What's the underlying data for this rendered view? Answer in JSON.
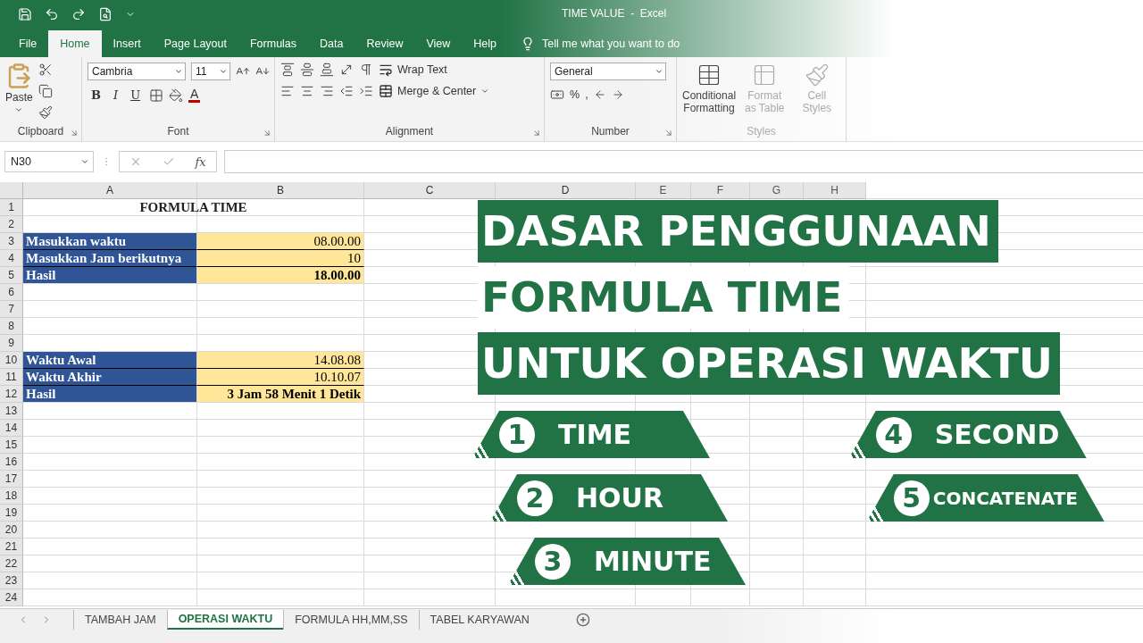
{
  "title_bar": {
    "title": "TIME VALUE  -  Excel"
  },
  "ribbon_tabs": [
    {
      "label": "File",
      "selected": false
    },
    {
      "label": "Home",
      "selected": true
    },
    {
      "label": "Insert",
      "selected": false
    },
    {
      "label": "Page Layout",
      "selected": false
    },
    {
      "label": "Formulas",
      "selected": false
    },
    {
      "label": "Data",
      "selected": false
    },
    {
      "label": "Review",
      "selected": false
    },
    {
      "label": "View",
      "selected": false
    },
    {
      "label": "Help",
      "selected": false
    }
  ],
  "tell_me": "Tell me what you want to do",
  "ribbon": {
    "clipboard": {
      "paste": "Paste",
      "label": "Clipboard"
    },
    "font": {
      "font_name": "Cambria",
      "font_size": "11",
      "bold": "B",
      "italic": "I",
      "underline": "U",
      "font_color": "A",
      "label": "Font"
    },
    "alignment": {
      "wrap_text": "Wrap Text",
      "merge": "Merge & Center",
      "label": "Alignment"
    },
    "number": {
      "format": "General",
      "percent": "%",
      "comma": ",",
      "label": "Number"
    },
    "styles": {
      "items": [
        "Conditional Formatting",
        "Format as Table",
        "Cell Styles"
      ],
      "label": "Styles"
    }
  },
  "formula_bar": {
    "name_box": "N30",
    "fx": "fx"
  },
  "sheet": {
    "columns": [
      "A",
      "B",
      "C",
      "D",
      "E",
      "F",
      "G",
      "H"
    ],
    "rows": [
      {
        "number": "1",
        "title": "FORMULA TIME"
      },
      {
        "number": "2"
      },
      {
        "number": "3",
        "a": "Masukkan waktu",
        "b": "08.00.00",
        "b_bold": false
      },
      {
        "number": "4",
        "a": "Masukkan Jam berikutnya",
        "b": "10",
        "b_bold": false
      },
      {
        "number": "5",
        "a": "Hasil",
        "b": "18.00.00",
        "b_bold": true
      },
      {
        "number": "6"
      },
      {
        "number": "7"
      },
      {
        "number": "8"
      },
      {
        "number": "9"
      },
      {
        "number": "10",
        "a": "Waktu Awal",
        "b": "14.08.08",
        "b_bold": false
      },
      {
        "number": "11",
        "a": "Waktu Akhir",
        "b": "10.10.07",
        "b_bold": false
      },
      {
        "number": "12",
        "a": "Hasil",
        "b": "3 Jam 58 Menit 1 Detik",
        "b_bold": true
      },
      {
        "number": "13"
      },
      {
        "number": "14"
      },
      {
        "number": "15"
      },
      {
        "number": "16"
      },
      {
        "number": "17"
      },
      {
        "number": "18"
      },
      {
        "number": "19"
      },
      {
        "number": "20"
      },
      {
        "number": "21"
      },
      {
        "number": "22"
      },
      {
        "number": "23"
      },
      {
        "number": "24"
      }
    ]
  },
  "overlay": {
    "headlines": [
      {
        "text": "DASAR PENGGUNAAN",
        "boxed": true
      },
      {
        "text": "FORMULA TIME",
        "boxed": false
      },
      {
        "text": "UNTUK OPERASI WAKTU",
        "boxed": true
      }
    ],
    "badge_columns": [
      [
        {
          "number": "1",
          "label": "TIME"
        },
        {
          "number": "2",
          "label": "HOUR"
        },
        {
          "number": "3",
          "label": "MINUTE"
        }
      ],
      [
        {
          "number": "4",
          "label": "SECOND"
        },
        {
          "number": "5",
          "label": "CONCATENATE"
        }
      ]
    ]
  },
  "sheet_tabs": [
    {
      "label": "TAMBAH JAM",
      "selected": false
    },
    {
      "label": "OPERASI WAKTU",
      "selected": true
    },
    {
      "label": "FORMULA HH,MM,SS",
      "selected": false
    },
    {
      "label": "TABEL KARYAWAN",
      "selected": false
    }
  ]
}
